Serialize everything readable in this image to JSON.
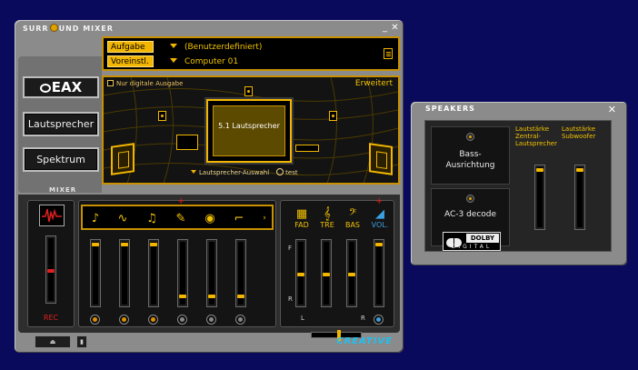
{
  "mixer": {
    "title_part1": "SURR",
    "title_part2": "UND MIXER",
    "minimize": "_",
    "close": "✕",
    "nav": {
      "eax": "EAX",
      "speakers": "Lautsprecher",
      "spectrum": "Spektrum"
    },
    "task_label": "Aufgabe",
    "task_value": "(Benutzerdefiniert)",
    "preset_label": "Voreinstl.",
    "preset_value": "Computer 01",
    "digital_only": "Nur digitale Ausgabe",
    "advanced": "Erweitert",
    "center_text": "5.1 Lautsprecher",
    "speaker_select": "Lautsprecher-Auswahl",
    "test": "test",
    "section_label": "MIXER",
    "rec_label": "REC",
    "fad_label": "FAD",
    "tre_label": "TRE",
    "bas_label": "BAS",
    "vol_label": "VOL.",
    "f_label": "F",
    "r_label": "R",
    "l_label": "L",
    "r2_label": "R",
    "brand": "CREATIVE"
  },
  "speakers": {
    "title": "SPEAKERS",
    "close": "✕",
    "bass_button": "Bass-\nAusrichtung",
    "ac3_button": "AC-3 decode",
    "dolby_word": "DOLBY",
    "dolby_digital": "DIGITAL",
    "center_label": "Lautstärke\nZentral-\nLautsprecher",
    "sub_label": "Lautstärke\nSubwoofer"
  },
  "colors": {
    "accent": "#f2b600",
    "background": "#0a0a5c",
    "rec_red": "#e02020",
    "vol_blue": "#3aa0e0"
  }
}
